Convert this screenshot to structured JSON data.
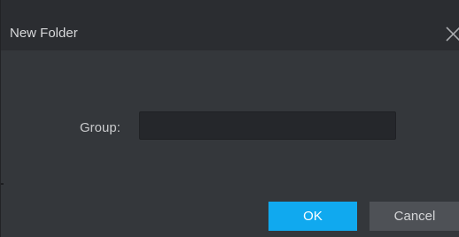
{
  "dialog": {
    "title": "New Folder",
    "close_icon": "close-icon",
    "group_label": "Group:",
    "group_value": "",
    "ok_label": "OK",
    "cancel_label": "Cancel"
  },
  "colors": {
    "titlebar_bg": "#2b2d31",
    "body_bg": "#34373b",
    "input_bg": "#25272b",
    "ok_bg": "#10a9ef",
    "cancel_bg": "#4e5156"
  }
}
